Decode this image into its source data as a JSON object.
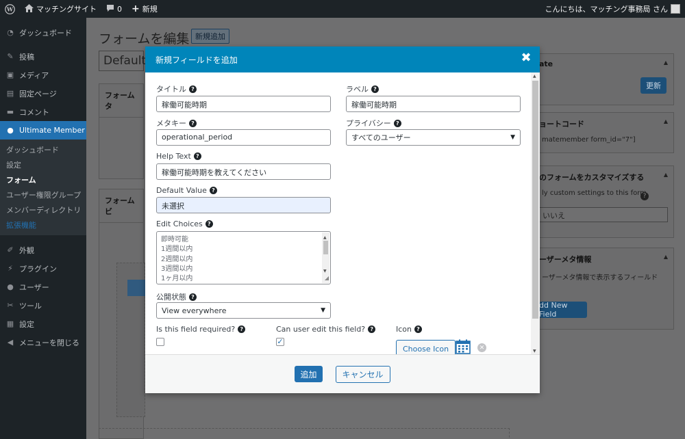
{
  "adminbar": {
    "site_name": "マッチングサイト",
    "comments_count": "0",
    "new_label": "新規",
    "greeting": "こんにちは、マッチング事務局 さん"
  },
  "sidebar": {
    "items_top": [
      {
        "label": "ダッシュボード",
        "icon": "dashboard-icon"
      },
      {
        "label": "投稿",
        "icon": "pin-icon"
      },
      {
        "label": "メディア",
        "icon": "media-icon"
      },
      {
        "label": "固定ページ",
        "icon": "page-icon"
      },
      {
        "label": "コメント",
        "icon": "comment-icon"
      }
    ],
    "current": {
      "label": "Ultimate Member",
      "icon": "user-icon"
    },
    "submenu": [
      "ダッシュボード",
      "設定",
      "フォーム",
      "ユーザー権限グループ",
      "メンバーディレクトリ",
      "拡張機能"
    ],
    "items_bottom": [
      {
        "label": "外観",
        "icon": "brush-icon"
      },
      {
        "label": "プラグイン",
        "icon": "plugin-icon"
      },
      {
        "label": "ユーザー",
        "icon": "users-icon"
      },
      {
        "label": "ツール",
        "icon": "wrench-icon"
      },
      {
        "label": "設定",
        "icon": "settings-icon"
      },
      {
        "label": "メニューを閉じる",
        "icon": "collapse-icon"
      }
    ]
  },
  "page": {
    "title": "フォームを編集",
    "add_new": "新規追加",
    "form_title_value": "Default",
    "box_form_type": "フォームタ",
    "box_form_builder": "フォームビ"
  },
  "right_boxes": {
    "update_title": "ate",
    "update_button": "更新",
    "shortcode_title": "ョートコード",
    "shortcode_text": "matemember form_id=\"7\"]",
    "customize_title": "のフォームをカスタマイズする",
    "customize_text": "ly custom settings to this form",
    "customize_select": "いいえ",
    "usermeta_title": "ーザーメタ情報",
    "usermeta_text": "ーザーメタ情報で表示するフィールド",
    "add_new_field": "dd New Field"
  },
  "modal": {
    "title": "新規フィールドを追加",
    "fields": {
      "title_label": "タイトル",
      "title_value": "稼働可能時期",
      "label_label": "ラベル",
      "label_value": "稼働可能時期",
      "metakey_label": "メタキー",
      "metakey_value": "operational_period",
      "privacy_label": "プライバシー",
      "privacy_value": "すべてのユーザー",
      "helptext_label": "Help Text",
      "helptext_value": "稼働可能時期を教えてください",
      "default_label": "Default Value",
      "default_value": "未選択",
      "choices_label": "Edit Choices",
      "choices": [
        "即時可能",
        "1週間以内",
        "2週間以内",
        "3週間以内",
        "1ヶ月以内"
      ],
      "visibility_label": "公開状態",
      "visibility_value": "View everywhere",
      "required_label": "Is this field required?",
      "required_checked": false,
      "editable_label": "Can user edit this field?",
      "editable_checked": true,
      "icon_label": "Icon",
      "choose_icon": "Choose Icon",
      "selected_icon": "calendar-icon"
    },
    "footer": {
      "add_button": "追加",
      "cancel_button": "キャンセル"
    }
  },
  "colors": {
    "accent": "#2271b1",
    "modal_header": "#0085ba",
    "adminbar": "#1d2327"
  }
}
